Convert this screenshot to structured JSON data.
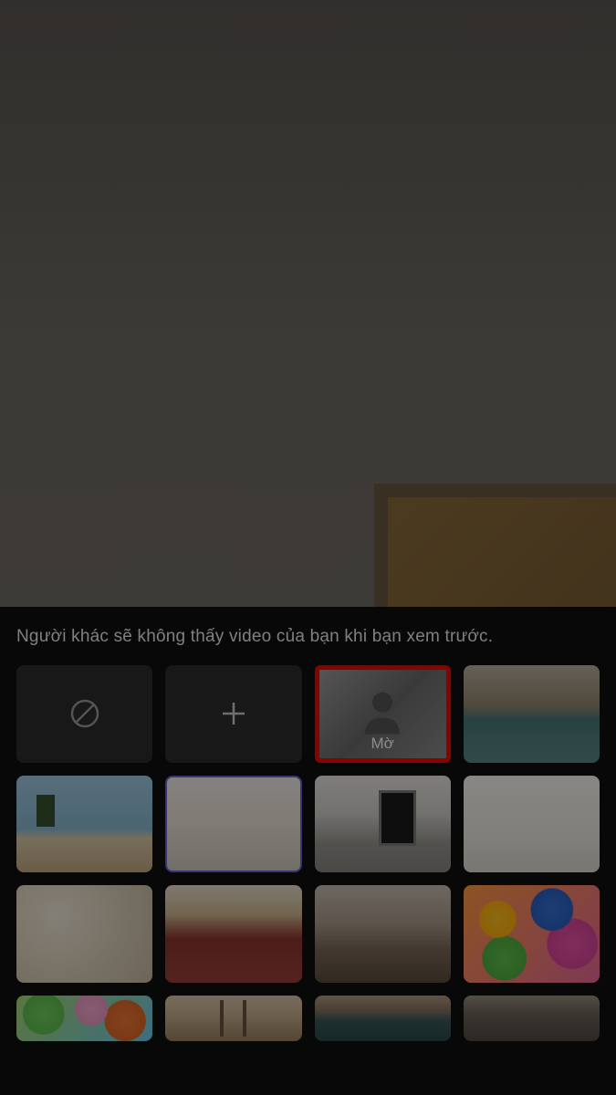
{
  "preview_message": "Người khác sẽ không thấy video của bạn khi bạn xem trước.",
  "tiles": {
    "none": {
      "name": "background-none",
      "icon": "none-icon"
    },
    "add": {
      "name": "background-add",
      "icon": "plus-icon"
    },
    "blur": {
      "name": "background-blur",
      "label": "Mờ",
      "highlighted": true
    },
    "backgrounds": [
      {
        "name": "bg-office-lockers"
      },
      {
        "name": "bg-beach-palms"
      },
      {
        "name": "bg-white-room",
        "selected": true
      },
      {
        "name": "bg-mirror-room"
      },
      {
        "name": "bg-white-gallery"
      },
      {
        "name": "bg-abstract-swirl"
      },
      {
        "name": "bg-lounge-red"
      },
      {
        "name": "bg-loft-interior"
      },
      {
        "name": "bg-balloons-colorful"
      },
      {
        "name": "bg-balloons-party"
      },
      {
        "name": "bg-golden-bridge"
      },
      {
        "name": "bg-library-room"
      },
      {
        "name": "bg-classroom"
      }
    ]
  }
}
